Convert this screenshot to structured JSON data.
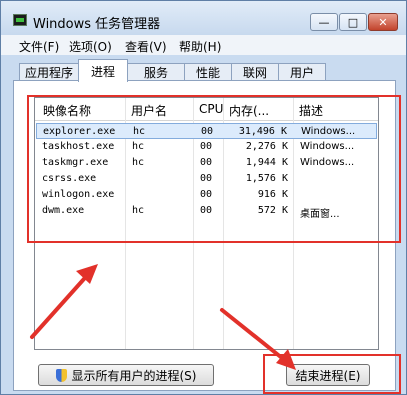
{
  "window": {
    "title": "Windows 任务管理器",
    "controls": {
      "minimize": "—",
      "maximize": "□",
      "close": "✕"
    }
  },
  "menu": [
    "文件(F)",
    "选项(O)",
    "查看(V)",
    "帮助(H)"
  ],
  "tabs": [
    {
      "label": "应用程序",
      "active": false
    },
    {
      "label": "进程",
      "active": true
    },
    {
      "label": "服务",
      "active": false
    },
    {
      "label": "性能",
      "active": false
    },
    {
      "label": "联网",
      "active": false
    },
    {
      "label": "用户",
      "active": false
    }
  ],
  "process_table": {
    "columns": [
      "映像名称",
      "用户名",
      "CPU",
      "内存(...",
      "描述"
    ],
    "rows": [
      {
        "name": "explorer.exe",
        "user": "hc",
        "cpu": "00",
        "mem": "31,496 K",
        "desc": "Windows...",
        "selected": true
      },
      {
        "name": "taskhost.exe",
        "user": "hc",
        "cpu": "00",
        "mem": "2,276 K",
        "desc": "Windows...",
        "selected": false
      },
      {
        "name": "taskmgr.exe",
        "user": "hc",
        "cpu": "00",
        "mem": "1,944 K",
        "desc": "Windows...",
        "selected": false
      },
      {
        "name": "csrss.exe",
        "user": "",
        "cpu": "00",
        "mem": "1,576 K",
        "desc": "",
        "selected": false
      },
      {
        "name": "winlogon.exe",
        "user": "",
        "cpu": "00",
        "mem": "916 K",
        "desc": "",
        "selected": false
      },
      {
        "name": "dwm.exe",
        "user": "hc",
        "cpu": "00",
        "mem": "572 K",
        "desc": "桌面窗...",
        "selected": false
      }
    ]
  },
  "buttons": {
    "show_all": "显示所有用户的进程(S)",
    "end_process": "结束进程(E)"
  },
  "annotation_colors": {
    "highlight": "#e2312a"
  }
}
